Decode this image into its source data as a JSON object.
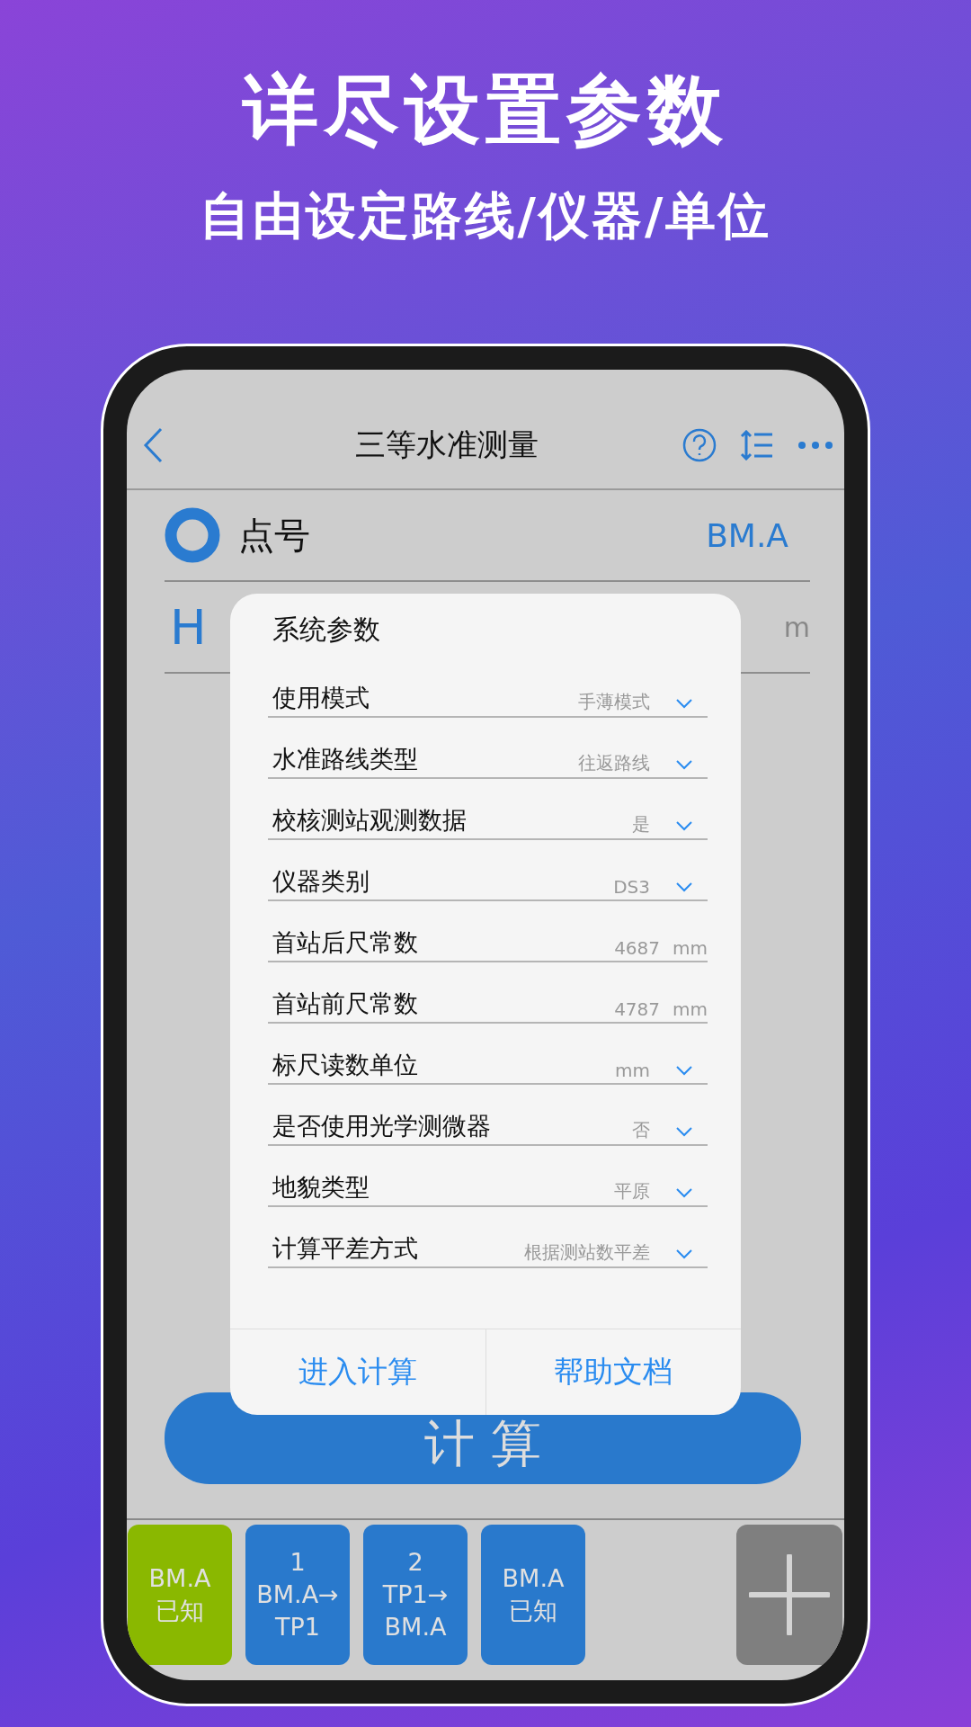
{
  "header": {
    "title": "详尽设置参数",
    "subtitle": "自由设定路线/仪器/单位"
  },
  "nav": {
    "title": "三等水准测量"
  },
  "point": {
    "label": "点号",
    "value": "BM.A"
  },
  "height": {
    "symbol": "H",
    "unit": "m"
  },
  "dialog": {
    "title": "系统参数",
    "rows": [
      {
        "label": "使用模式",
        "value": "手薄模式",
        "kind": "select"
      },
      {
        "label": "水准路线类型",
        "value": "往返路线",
        "kind": "select"
      },
      {
        "label": "校核测站观测数据",
        "value": "是",
        "kind": "select"
      },
      {
        "label": "仪器类别",
        "value": "DS3",
        "kind": "select"
      },
      {
        "label": "首站后尺常数",
        "value": "4687",
        "unit": "mm",
        "kind": "number"
      },
      {
        "label": "首站前尺常数",
        "value": "4787",
        "unit": "mm",
        "kind": "number"
      },
      {
        "label": "标尺读数单位",
        "value": "mm",
        "kind": "select"
      },
      {
        "label": "是否使用光学测微器",
        "value": "否",
        "kind": "select"
      },
      {
        "label": "地貌类型",
        "value": "平原",
        "kind": "select"
      },
      {
        "label": "计算平差方式",
        "value": "根据测站数平差",
        "kind": "select"
      }
    ],
    "buttons": [
      "进入计算",
      "帮助文档"
    ]
  },
  "calculate_button": "计 算",
  "stations": [
    {
      "lines": [
        "BM.A",
        "已知"
      ],
      "color": "#8ab800"
    },
    {
      "lines": [
        "1",
        "BM.A→",
        "TP1"
      ],
      "color": "#2979cc"
    },
    {
      "lines": [
        "2",
        "TP1→",
        "BM.A"
      ],
      "color": "#2979cc"
    },
    {
      "lines": [
        "BM.A",
        "已知"
      ],
      "color": "#2979cc"
    }
  ]
}
